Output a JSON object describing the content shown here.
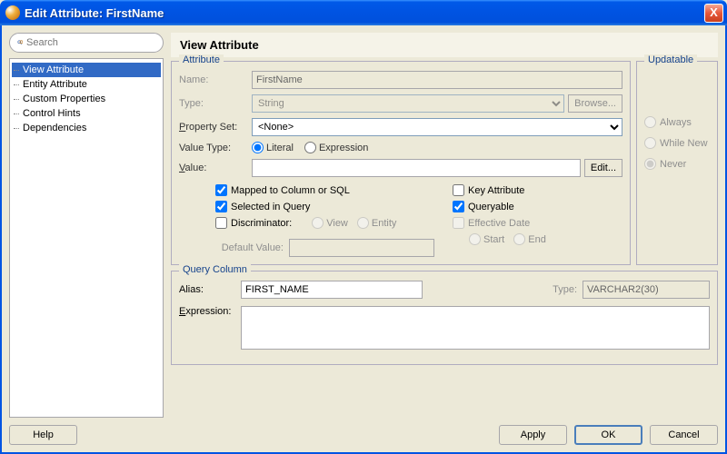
{
  "window": {
    "title": "Edit Attribute: FirstName",
    "close_label": "X"
  },
  "sidebar": {
    "search_placeholder": "Search",
    "items": [
      {
        "label": "View Attribute"
      },
      {
        "label": "Entity Attribute"
      },
      {
        "label": "Custom Properties"
      },
      {
        "label": "Control Hints"
      },
      {
        "label": "Dependencies"
      }
    ]
  },
  "page": {
    "heading": "View Attribute"
  },
  "attribute": {
    "legend": "Attribute",
    "name_label": "Name:",
    "name_value": "FirstName",
    "type_label": "Type:",
    "type_value": "String",
    "browse_label": "Browse...",
    "property_set_label": "Property Set:",
    "property_set_value": "<None>",
    "value_type_label": "Value Type:",
    "literal_label": "Literal",
    "expression_label": "Expression",
    "value_label": "Value:",
    "value_value": "",
    "edit_label": "Edit...",
    "mapped_label": "Mapped to Column or SQL",
    "selected_label": "Selected in Query",
    "discriminator_label": "Discriminator:",
    "disc_view_label": "View",
    "disc_entity_label": "Entity",
    "default_value_label": "Default Value:",
    "default_value_value": "",
    "key_label": "Key Attribute",
    "queryable_label": "Queryable",
    "effective_date_label": "Effective Date",
    "ed_start_label": "Start",
    "ed_end_label": "End"
  },
  "updatable": {
    "legend": "Updatable",
    "always_label": "Always",
    "while_new_label": "While New",
    "never_label": "Never"
  },
  "query": {
    "legend": "Query Column",
    "alias_label": "Alias:",
    "alias_value": "FIRST_NAME",
    "type_label": "Type:",
    "type_value": "VARCHAR2(30)",
    "expression_label": "Expression:",
    "expression_value": ""
  },
  "buttons": {
    "help": "Help",
    "apply": "Apply",
    "ok": "OK",
    "cancel": "Cancel"
  }
}
